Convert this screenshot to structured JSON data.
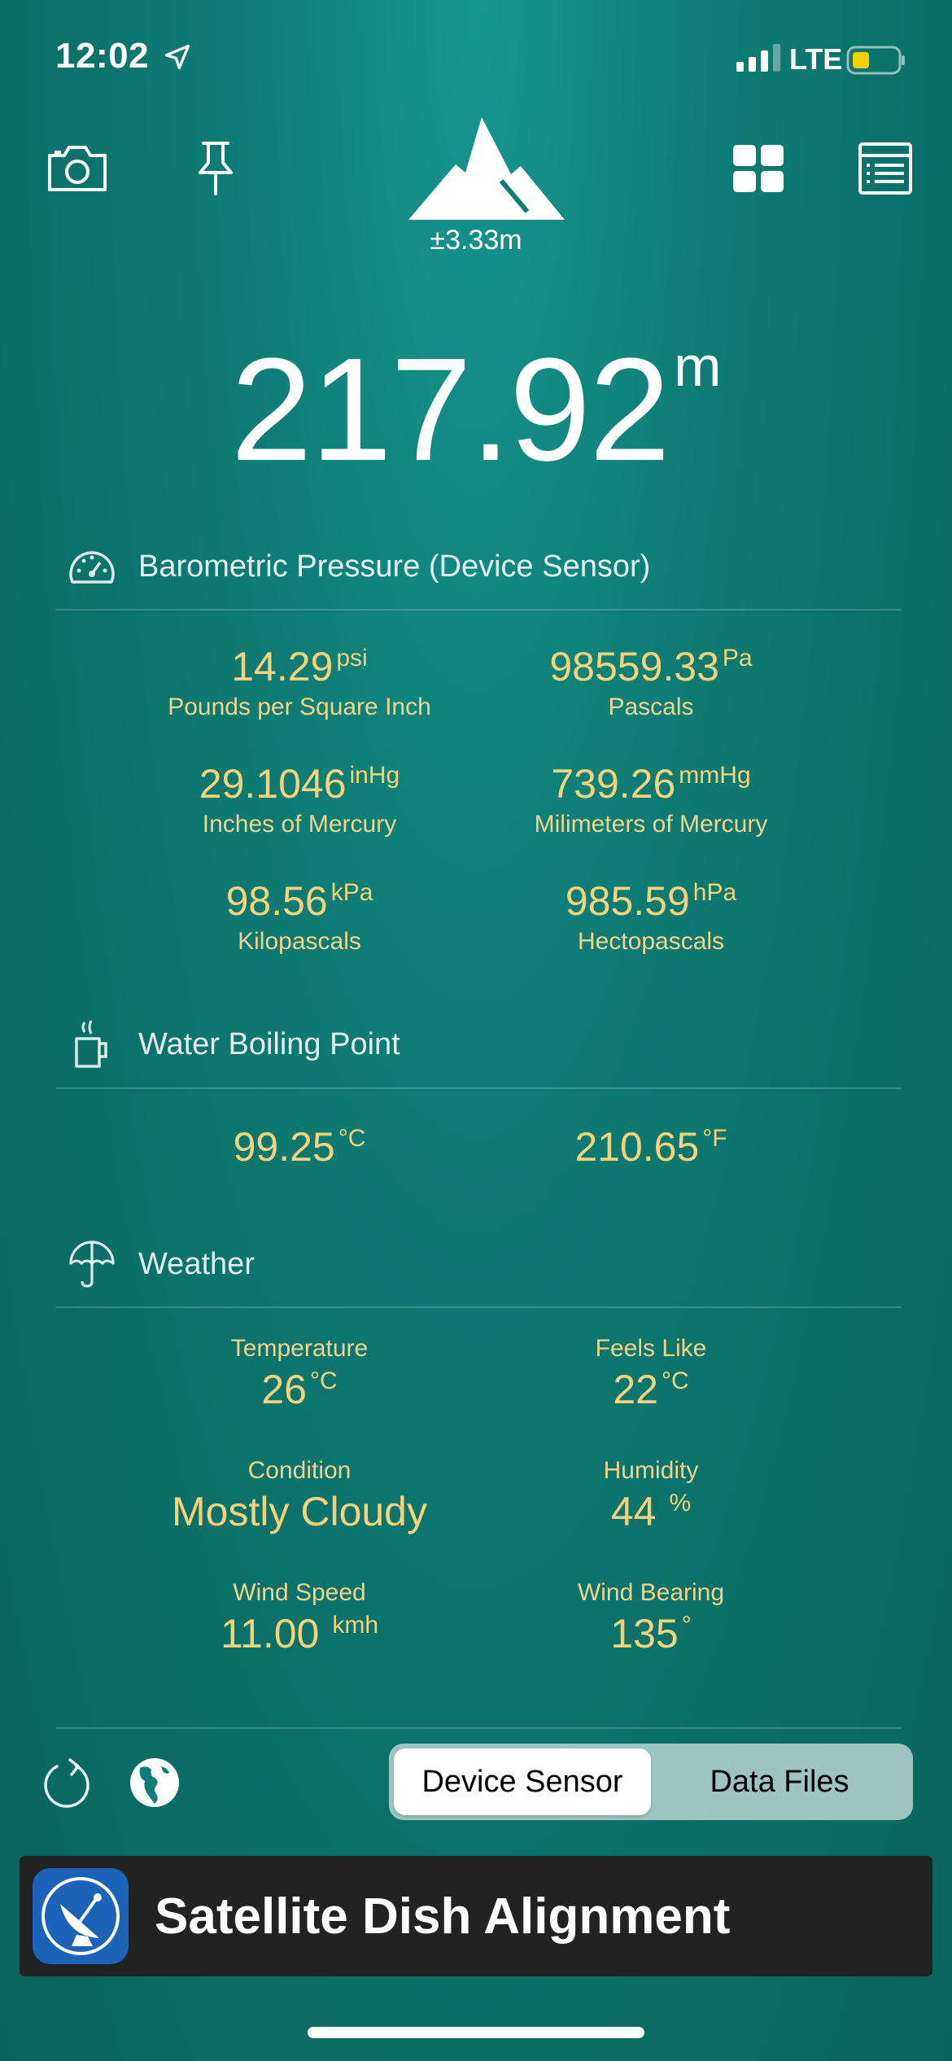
{
  "status_bar": {
    "time": "12:02",
    "network": "LTE",
    "location_icon": "location-arrow-icon",
    "battery_icon": "battery-icon"
  },
  "toolbar": {
    "camera_icon": "camera-icon",
    "pin_icon": "pin-icon",
    "mountain_icon": "mountain-icon",
    "grid_icon": "grid-icon",
    "list_icon": "list-icon",
    "accuracy": "±3.33m"
  },
  "altitude": {
    "value": "217.92",
    "unit": "m"
  },
  "barometric": {
    "title": "Barometric Pressure (Device Sensor)",
    "icon": "gauge-icon",
    "items": [
      {
        "value": "14.29",
        "unit": "psi",
        "label": "Pounds per Square Inch"
      },
      {
        "value": "98559.33",
        "unit": "Pa",
        "label": "Pascals"
      },
      {
        "value": "29.1046",
        "unit": "inHg",
        "label": "Inches of Mercury"
      },
      {
        "value": "739.26",
        "unit": "mmHg",
        "label": "Milimeters of Mercury"
      },
      {
        "value": "98.56",
        "unit": "kPa",
        "label": "Kilopascals"
      },
      {
        "value": "985.59",
        "unit": "hPa",
        "label": "Hectopascals"
      }
    ]
  },
  "boiling": {
    "title": "Water Boiling Point",
    "icon": "mug-icon",
    "celsius": {
      "value": "99.25",
      "unit": "°C"
    },
    "fahrenheit": {
      "value": "210.65",
      "unit": "°F"
    }
  },
  "weather": {
    "title": "Weather",
    "icon": "umbrella-icon",
    "items": [
      {
        "label": "Temperature",
        "value": "26",
        "unit": "°C"
      },
      {
        "label": "Feels Like",
        "value": "22",
        "unit": "°C"
      },
      {
        "label": "Condition",
        "value": "Mostly Cloudy",
        "unit": ""
      },
      {
        "label": "Humidity",
        "value": "44",
        "unit": "%"
      },
      {
        "label": "Wind Speed",
        "value": "11.00",
        "unit": "kmh"
      },
      {
        "label": "Wind Bearing",
        "value": "135",
        "unit": "°"
      }
    ]
  },
  "bottom": {
    "refresh_icon": "refresh-icon",
    "globe_icon": "globe-icon",
    "segment": {
      "device_sensor": "Device Sensor",
      "data_files": "Data Files",
      "selected": "Device Sensor"
    }
  },
  "ad": {
    "text": "Satellite Dish Alignment",
    "icon": "satellite-dish-icon"
  }
}
